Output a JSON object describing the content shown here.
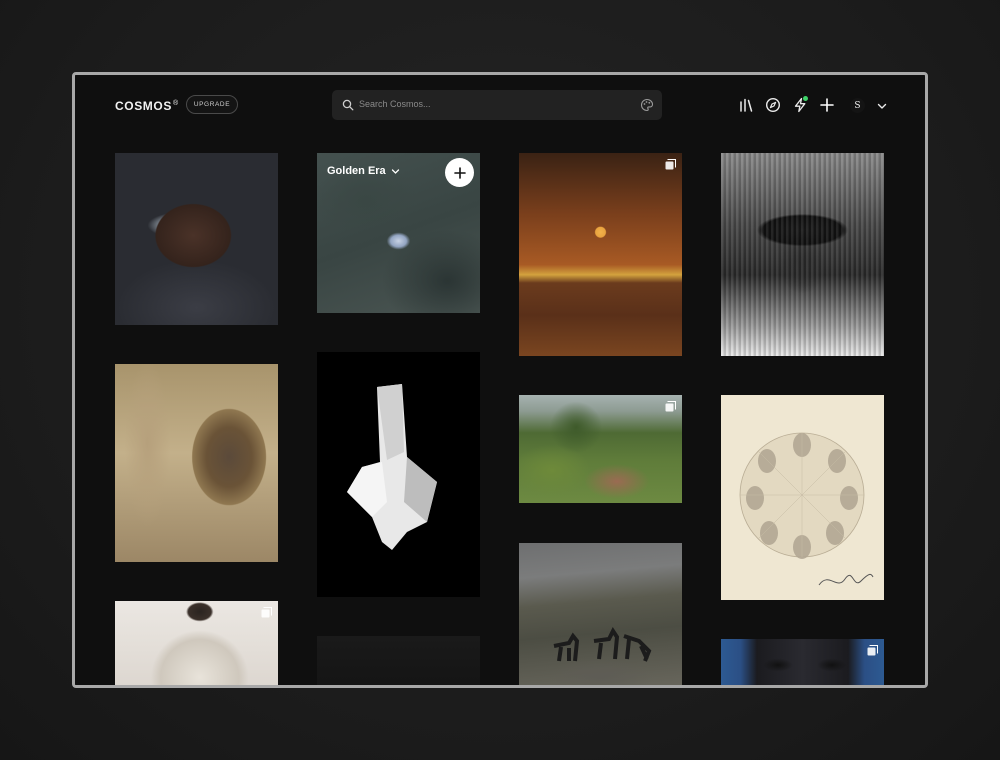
{
  "header": {
    "logo": "COSMOS",
    "logo_mark": "®",
    "upgrade_label": "UPGRADE",
    "search_placeholder": "Search Cosmos...",
    "avatar_initial": "S"
  },
  "nav_icons": [
    "library-icon",
    "compass-icon",
    "lightning-icon",
    "plus-icon",
    "avatar",
    "chevron-down-icon"
  ],
  "board_overlay": {
    "label": "Golden Era"
  },
  "grid": {
    "columns": 4,
    "tiles": [
      {
        "name": "portrait-silver-face",
        "column": 1,
        "multi": false
      },
      {
        "name": "cave-sculpture",
        "column": 1,
        "multi": false
      },
      {
        "name": "white-dress-figure",
        "column": 1,
        "multi": true
      },
      {
        "name": "butterfly-water",
        "column": 2,
        "multi": false,
        "board": "Golden Era"
      },
      {
        "name": "white-crystal",
        "column": 2,
        "multi": false
      },
      {
        "name": "dark-image",
        "column": 2,
        "multi": false
      },
      {
        "name": "sunset-sea",
        "column": 3,
        "multi": true
      },
      {
        "name": "garden-landscape",
        "column": 3,
        "multi": true
      },
      {
        "name": "horses-hillside",
        "column": 3,
        "multi": false
      },
      {
        "name": "hat-figure-glass",
        "column": 4,
        "multi": false
      },
      {
        "name": "circular-sketch",
        "column": 4,
        "multi": false
      },
      {
        "name": "blue-face",
        "column": 4,
        "multi": true
      }
    ]
  },
  "colors": {
    "background": "#0f0f0f",
    "search_bg": "#222222",
    "notification_dot": "#3fd46a"
  }
}
